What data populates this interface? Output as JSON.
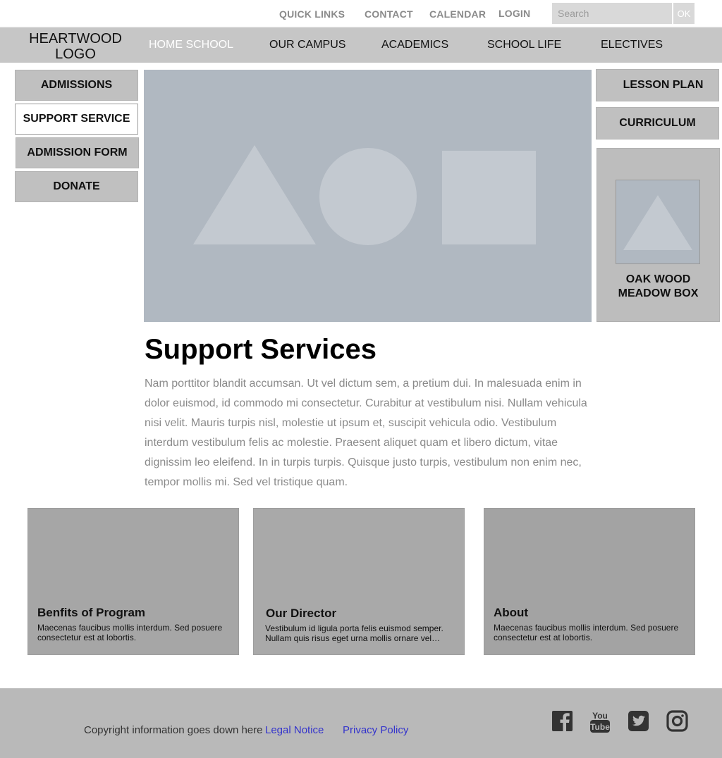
{
  "utility_nav": {
    "links": [
      "QUICK LINKS",
      "CONTACT",
      "CALENDAR",
      "LOGIN"
    ],
    "search_placeholder": "Search",
    "search_button": "OK"
  },
  "logo": {
    "line1": "HEARTWOOD",
    "line2": "LOGO"
  },
  "main_nav": {
    "items": [
      "HOME SCHOOL",
      "OUR CAMPUS",
      "ACADEMICS",
      "SCHOOL LIFE",
      "ELECTIVES"
    ],
    "active": "HOME SCHOOL"
  },
  "sidebar": {
    "items": [
      "ADMISSIONS",
      "SUPPORT SERVICE",
      "ADMISSION FORM",
      "DONATE"
    ],
    "selected": "SUPPORT SERVICE"
  },
  "right_column": {
    "buttons": [
      "LESSON PLAN",
      "CURRICULUM"
    ],
    "promo": {
      "line1": "OAK WOOD",
      "line2": "MEADOW BOX"
    }
  },
  "content": {
    "title": "Support Services",
    "body": "Nam porttitor blandit accumsan. Ut vel dictum sem, a pretium dui. In malesuada enim in dolor euismod, id commodo mi consectetur. Curabitur at vestibulum nisi. Nullam vehicula nisi velit. Mauris turpis nisl, molestie ut ipsum et, suscipit vehicula odio. Vestibulum interdum vestibulum felis ac molestie. Praesent aliquet quam et libero dictum, vitae dignissim leo eleifend. In in turpis turpis. Quisque justo turpis, vestibulum non enim nec, tempor mollis mi. Sed vel tristique quam."
  },
  "cards": [
    {
      "title": "Benfits of Program",
      "text": "Maecenas faucibus mollis interdum. Sed posuere consectetur est at lobortis."
    },
    {
      "title": "Our Director",
      "text": "Vestibulum id ligula porta felis euismod semper. Nullam quis risus eget urna mollis ornare vel…"
    },
    {
      "title": "About",
      "text": "Maecenas faucibus mollis interdum. Sed posuere consectetur est at lobortis."
    }
  ],
  "footer": {
    "copyright": "Copyright information goes down here",
    "links": [
      "Legal Notice",
      "Privacy Policy"
    ],
    "social_icons": [
      "facebook-icon",
      "youtube-icon",
      "twitter-icon",
      "instagram-icon"
    ]
  },
  "colors": {
    "nav_background": "#c6c6c6",
    "button_background": "#c0c0c0",
    "hero_placeholder": "#b0b8c1",
    "card_background": "#a6a6a6",
    "footer_background": "#b9b9b9",
    "footer_link": "#3333cc",
    "body_text": "#8a8a8a"
  }
}
